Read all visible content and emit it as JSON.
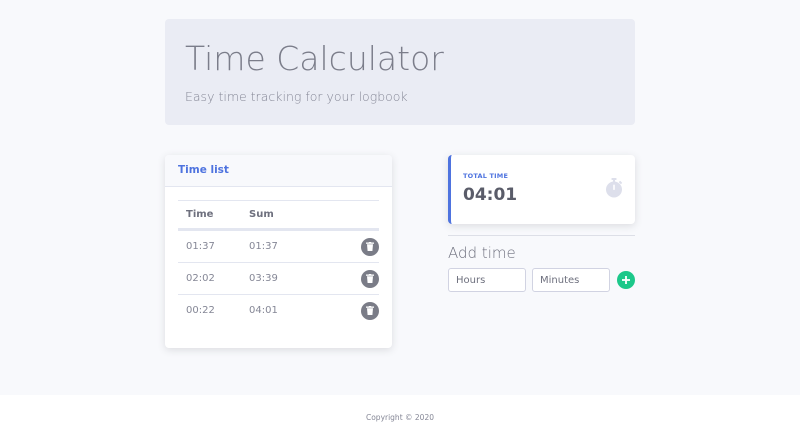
{
  "header": {
    "title": "Time Calculator",
    "subtitle": "Easy time tracking for your logbook"
  },
  "time_list": {
    "title": "Time list",
    "columns": [
      "Time",
      "Sum"
    ],
    "rows": [
      {
        "time": "01:37",
        "sum": "01:37"
      },
      {
        "time": "02:02",
        "sum": "03:39"
      },
      {
        "time": "00:22",
        "sum": "04:01"
      }
    ]
  },
  "total": {
    "label": "Total time",
    "value": "04:01",
    "icon": "stopwatch-icon"
  },
  "add_time": {
    "title": "Add time",
    "hours_placeholder": "Hours",
    "minutes_placeholder": "Minutes",
    "add_icon": "plus-icon"
  },
  "footer": {
    "copyright": "Copyright © 2020"
  },
  "colors": {
    "primary": "#4e73df",
    "success": "#1cc88a",
    "delete": "#7a7c87"
  }
}
